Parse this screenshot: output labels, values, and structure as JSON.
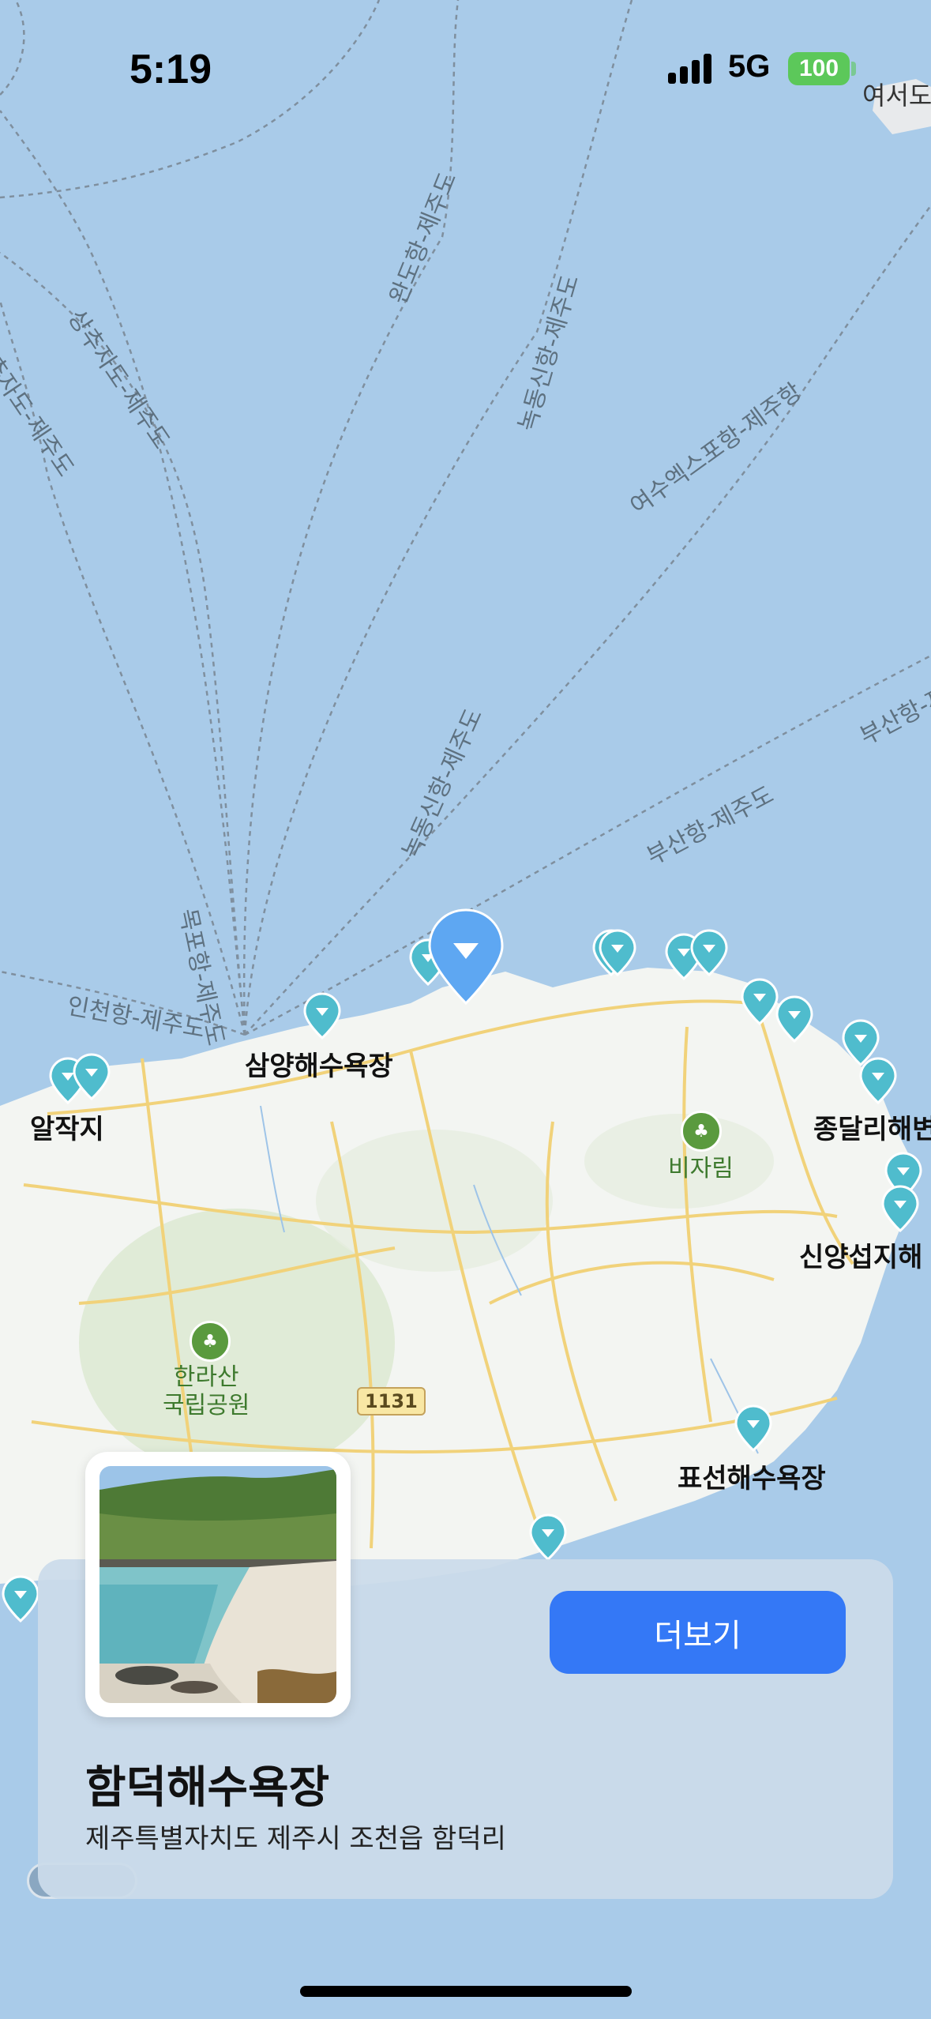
{
  "status_bar": {
    "time": "5:19",
    "network": "5G",
    "battery": "100"
  },
  "map": {
    "ferry_routes": [
      "완도항-제주도",
      "상추자도-제주도",
      "추자도-제주도",
      "녹동신항-제주도",
      "여수엑스포항-제주항",
      "녹동신항-제주도",
      "부산항-제주도",
      "부산항-제",
      "목포항-제주도",
      "인천항-제주도"
    ],
    "places": [
      "삼양해수욕장",
      "알작지",
      "종달리해변",
      "신양섭지해",
      "표선해수욕장",
      "여서도"
    ],
    "parks": [
      {
        "label": "비자림",
        "icon": "forest-icon"
      },
      {
        "label": "한라산\n국립공원",
        "icon": "forest-icon"
      }
    ],
    "road_number": "1131",
    "colors": {
      "sea": "#a9cbe9",
      "land": "#f3f5f2",
      "road": "#f1d27a",
      "pin": "#4fbccd",
      "selected_pin": "#5ea7f2"
    }
  },
  "card": {
    "title": "함덕해수욕장",
    "address": "제주특별자치도 제주시 조천읍 함덕리",
    "more_button": "더보기",
    "thumbnail": "beach-photo"
  }
}
